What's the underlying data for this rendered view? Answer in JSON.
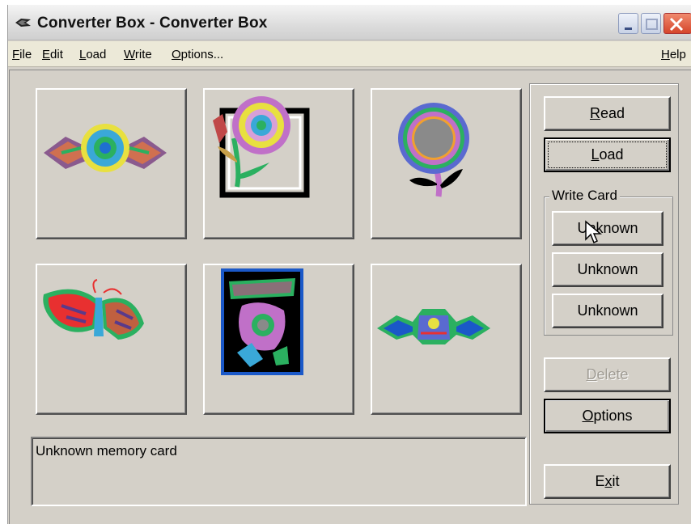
{
  "window": {
    "title": "Converter Box - Converter Box"
  },
  "menu": {
    "file": {
      "pre": "",
      "u": "F",
      "post": "ile"
    },
    "edit": {
      "pre": "",
      "u": "E",
      "post": "dit"
    },
    "load": {
      "pre": "",
      "u": "L",
      "post": "oad"
    },
    "write": {
      "pre": "",
      "u": "W",
      "post": "rite"
    },
    "options": {
      "pre": "",
      "u": "O",
      "post": "ptions..."
    },
    "help": {
      "pre": "",
      "u": "H",
      "post": "elp"
    }
  },
  "buttons": {
    "read": {
      "pre": "",
      "u": "R",
      "post": "ead"
    },
    "load": {
      "pre": "",
      "u": "L",
      "post": "oad"
    },
    "delete": {
      "pre": "",
      "u": "D",
      "post": "elete"
    },
    "options": {
      "pre": "",
      "u": "O",
      "post": "ptions"
    },
    "exit": {
      "pre": "E",
      "u": "x",
      "post": "it"
    }
  },
  "write_card": {
    "label": "Write Card",
    "slots": [
      "Unknown",
      "Unknown",
      "Unknown"
    ]
  },
  "status": {
    "message": "Unknown memory card"
  },
  "designs": [
    {
      "icon": "floral-band-design-icon"
    },
    {
      "icon": "sunflower-frame-design-icon"
    },
    {
      "icon": "sunflower-design-icon"
    },
    {
      "icon": "butterfly-design-icon"
    },
    {
      "icon": "brewer-card-design-icon"
    },
    {
      "icon": "border-motif-design-icon"
    }
  ],
  "colors": {
    "face": "#d4d0c8",
    "close": "#d5452a",
    "disabled_text": "#a09c94"
  }
}
